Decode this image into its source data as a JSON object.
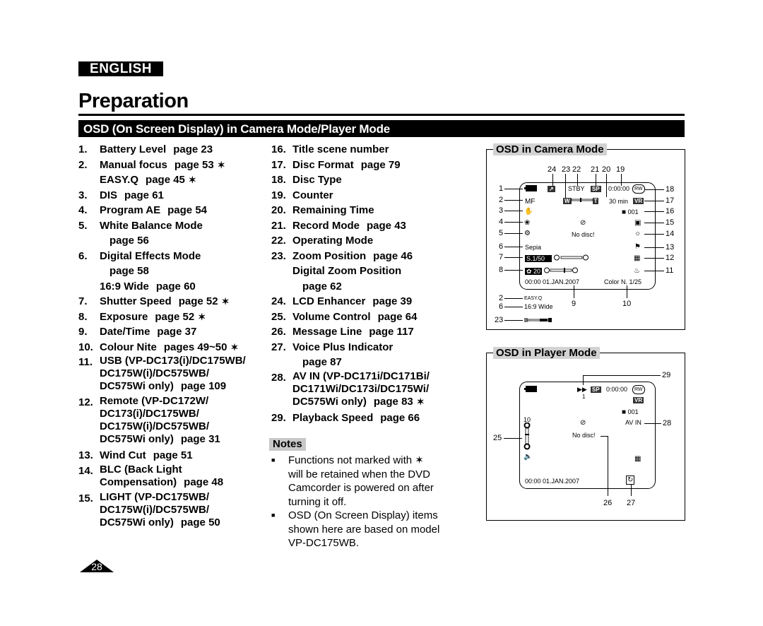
{
  "header": {
    "language": "ENGLISH",
    "title": "Preparation",
    "section": "OSD (On Screen Display) in Camera Mode/Player Mode"
  },
  "items_col1": [
    {
      "num": "1.",
      "lines": [
        "Battery Level"
      ],
      "page": "page 23",
      "star": false
    },
    {
      "num": "2.",
      "lines": [
        "Manual focus"
      ],
      "page": "page 53",
      "star": true
    },
    {
      "num": "",
      "lines": [
        "EASY.Q"
      ],
      "page": "page 45",
      "star": true
    },
    {
      "num": "3.",
      "lines": [
        "DIS"
      ],
      "page": "page 61",
      "star": false
    },
    {
      "num": "4.",
      "lines": [
        "Program AE"
      ],
      "page": "page 54",
      "star": false
    },
    {
      "num": "5.",
      "lines": [
        "White Balance Mode"
      ],
      "page_line": "page 56",
      "star": false
    },
    {
      "num": "6.",
      "lines": [
        "Digital Effects Mode"
      ],
      "page_line": "page 58",
      "star": false
    },
    {
      "num": "",
      "lines": [
        "16:9 Wide"
      ],
      "page": "page 60",
      "star": false
    },
    {
      "num": "7.",
      "lines": [
        "Shutter Speed"
      ],
      "page": "page 52",
      "star": true
    },
    {
      "num": "8.",
      "lines": [
        "Exposure"
      ],
      "page": "page 52",
      "star": true
    },
    {
      "num": "9.",
      "lines": [
        "Date/Time"
      ],
      "page": "page 37",
      "star": false
    },
    {
      "num": "10.",
      "lines": [
        "Colour Nite"
      ],
      "page": "pages 49~50",
      "star": true
    },
    {
      "num": "11.",
      "lines": [
        "USB (VP-DC173(i)/DC175WB/",
        "DC175W(i)/DC575WB/",
        "DC575Wi only)"
      ],
      "page": "page 109",
      "star": false
    },
    {
      "num": "12.",
      "lines": [
        "Remote (VP-DC172W/",
        "DC173(i)/DC175WB/",
        "DC175W(i)/DC575WB/",
        "DC575Wi only)"
      ],
      "page": "page 31",
      "star": false
    },
    {
      "num": "13.",
      "lines": [
        "Wind Cut"
      ],
      "page": "page 51",
      "star": false
    },
    {
      "num": "14.",
      "lines": [
        "BLC (Back Light",
        "Compensation)"
      ],
      "page": "page 48",
      "star": false
    },
    {
      "num": "15.",
      "lines": [
        "LIGHT (VP-DC175WB/",
        "DC175W(i)/DC575WB/",
        "DC575Wi only)"
      ],
      "page": "page 50",
      "star": false
    }
  ],
  "items_col2": [
    {
      "num": "16.",
      "lines": [
        "Title scene number"
      ],
      "page": "",
      "star": false
    },
    {
      "num": "17.",
      "lines": [
        "Disc Format"
      ],
      "page": "page 79",
      "star": false
    },
    {
      "num": "18.",
      "lines": [
        "Disc Type"
      ],
      "page": "",
      "star": false
    },
    {
      "num": "19.",
      "lines": [
        "Counter"
      ],
      "page": "",
      "star": false
    },
    {
      "num": "20.",
      "lines": [
        "Remaining Time"
      ],
      "page": "",
      "star": false
    },
    {
      "num": "21.",
      "lines": [
        "Record Mode"
      ],
      "page": "page 43",
      "star": false
    },
    {
      "num": "22.",
      "lines": [
        "Operating Mode"
      ],
      "page": "",
      "star": false
    },
    {
      "num": "23.",
      "lines": [
        "Zoom Position"
      ],
      "page": "page 46",
      "star": false
    },
    {
      "num": "",
      "lines": [
        "Digital Zoom Position"
      ],
      "page_line": "page 62",
      "star": false
    },
    {
      "num": "24.",
      "lines": [
        "LCD Enhancer"
      ],
      "page": "page 39",
      "star": false
    },
    {
      "num": "25.",
      "lines": [
        "Volume Control"
      ],
      "page": "page 64",
      "star": false
    },
    {
      "num": "26.",
      "lines": [
        "Message Line"
      ],
      "page": "page 117",
      "star": false
    },
    {
      "num": "27.",
      "lines": [
        "Voice Plus Indicator"
      ],
      "page_line": "page 87",
      "star": false
    },
    {
      "num": "28.",
      "lines": [
        "AV IN (VP-DC171i/DC171Bi/",
        "DC171Wi/DC173i/DC175Wi/",
        "DC575Wi only)"
      ],
      "page": "page 83",
      "star": true
    },
    {
      "num": "29.",
      "lines": [
        "Playback Speed"
      ],
      "page": "page 66",
      "star": false
    }
  ],
  "notes": {
    "label": "Notes",
    "items": [
      {
        "lines": [
          "Functions not marked with ✶",
          "will be retained when the DVD",
          "Camcorder is powered on after",
          "turning it off."
        ]
      },
      {
        "lines": [
          "OSD (On Screen Display) items",
          "shown here are based on model",
          "VP-DC175WB."
        ]
      }
    ]
  },
  "star_symbol": "✶",
  "bullet_symbol": "■",
  "page_number": "28",
  "osd_camera": {
    "title": "OSD in Camera Mode",
    "top_callouts": [
      "24",
      "23",
      "22",
      "21",
      "20",
      "19"
    ],
    "left_callouts": [
      "1",
      "2",
      "3",
      "4",
      "5",
      "6",
      "7",
      "8"
    ],
    "right_callouts": [
      "18",
      "17",
      "16",
      "15",
      "14",
      "13",
      "12",
      "11"
    ],
    "bottom_callouts": [
      "9",
      "10"
    ],
    "outside_callouts": [
      "2",
      "6",
      "23"
    ],
    "stby": "STBY",
    "sp": "SP",
    "counter": "0:00:00",
    "rw": "RW",
    "remaining": "30 min",
    "vr": "VR",
    "scene": "001",
    "zoom_w": "W",
    "zoom_t": "T",
    "mf": "MF",
    "no_disc": "No disc!",
    "sepia": "Sepia",
    "shutter": "S.1/50",
    "exposure": "20",
    "datetime": "00:00 01.JAN.2007",
    "color_nite": "Color N. 1/25",
    "easyq": "EASY.Q",
    "wide": "16:9 Wide"
  },
  "osd_player": {
    "title": "OSD in Player Mode",
    "callouts": {
      "c29": "29",
      "c28": "28",
      "c25": "25",
      "c26": "26",
      "c27": "27"
    },
    "play_icon": "▶▶",
    "speed": "1",
    "sp": "SP",
    "counter": "0:00:00",
    "rw": "RW",
    "vr": "VR",
    "scene": "001",
    "volume": "10",
    "av_in": "AV IN",
    "no_disc": "No disc!",
    "datetime": "00:00 01.JAN.2007"
  }
}
